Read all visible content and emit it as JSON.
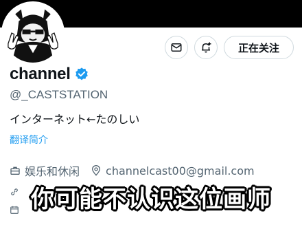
{
  "profile": {
    "name": "channel",
    "handle": "@_CASTSTATION",
    "bio": "インターネット←たのしい",
    "translate_label": "翻译简介",
    "category": "娱乐和休闲",
    "email": "channelcast00@gmail.com",
    "verified_icon": "verified-badge-icon",
    "verified_color": "#1d9bf0"
  },
  "actions": {
    "message_icon": "envelope-icon",
    "notify_icon": "bell-plus-icon",
    "follow_label": "正在关注"
  },
  "caption": {
    "text": "你可能不认识这位画师"
  },
  "colors": {
    "banner": "#000000",
    "link": "#1d9bf0",
    "secondary_text": "#536471",
    "border": "#cfd9de"
  }
}
